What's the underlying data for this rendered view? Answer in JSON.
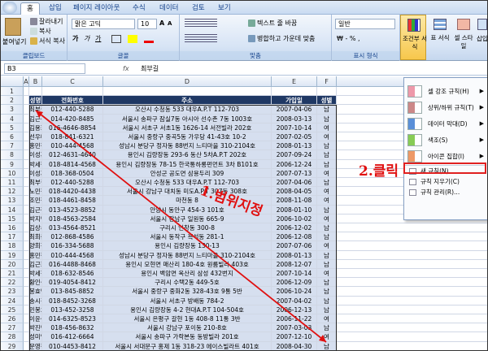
{
  "ribbon": {
    "tabs": [
      "홈",
      "삽입",
      "페이지 레이아웃",
      "수식",
      "데이터",
      "검토",
      "보기"
    ],
    "paste": "붙여넣기",
    "cut": "잘라내기",
    "copy": "복사",
    "format_painter": "서식 복사",
    "clipboard_group": "클립보드",
    "font_name": "맑은 고딕",
    "font_size": "10",
    "font_group": "글꼴",
    "wrap_text": "텍스트 줄 바꿈",
    "merge_center": "병합하고 가운데 맞춤",
    "align_group": "맞춤",
    "number_format": "일반",
    "number_group": "표시 형식",
    "cond_format": "조건부 서식",
    "table_format": "표 서식",
    "cell_style": "셀 스타일",
    "insert": "삽입"
  },
  "formula_bar": {
    "name_box": "B3",
    "fx": "fx",
    "value": "최부길"
  },
  "columns": [
    "A",
    "B",
    "C",
    "D",
    "E",
    "F",
    "G"
  ],
  "headers": [
    "성명",
    "전화번호",
    "주소",
    "가입일",
    "성별"
  ],
  "rows": [
    [
      "최부길",
      "012-440-5288",
      "오산시 수청동 533 대우A.P.T 112-703",
      "2007-04-06",
      "남"
    ],
    [
      "김근식",
      "014-420-8485",
      "서울시 송파구 잠실7동 아시아 선수촌 7동 1003호",
      "2008-03-13",
      "남"
    ],
    [
      "김용희",
      "016-4646-8854",
      "서울시 서초구 서초1동 1626-14 서전빌라 202호",
      "2007-10-14",
      "여"
    ],
    [
      "선우미경",
      "018-841-6321",
      "서울시 중랑구 중곡5동 가우당 41-43호 10-2",
      "2007-02-05",
      "여"
    ],
    [
      "홍민철",
      "010-444-4568",
      "성남시 분당구 정자동 88번지 느티마을 310-2104호",
      "2008-01-13",
      "남"
    ],
    [
      "이성훈",
      "012-4631-4640",
      "용인시 김량장동 293-6 동산 5차A.P.T 202호",
      "2007-09-24",
      "남"
    ],
    [
      "박세철",
      "018-4814-4568",
      "용인시 김량장동 78-15 한국통하롱펀먼트 3차 B101호",
      "2006-12-24",
      "남"
    ],
    [
      "이성훈",
      "018-368-0504",
      "안성군 공도면 삼용두리 309",
      "2007-07-13",
      "여"
    ],
    [
      "최부길",
      "012-440-5288",
      "오산시 수청동 533 대우A.P.T 112-703",
      "2007-04-06",
      "남"
    ],
    [
      "노민정",
      "018-4420-4438",
      "서울시 강남구 대치동 미도A.P.T 307동 308호",
      "2008-04-05",
      "여"
    ],
    [
      "조민정",
      "018-4461-8458",
      "마천동 8",
      "2008-11-08",
      "여"
    ],
    [
      "김근정",
      "013-4523-8852",
      "안양시 동안구 454-3 101호",
      "2008-01-10",
      "남"
    ],
    [
      "박지민",
      "018-4563-2584",
      "서울시 강남구 일원동 665-9",
      "2006-10-02",
      "여"
    ],
    [
      "김상수",
      "013-4564-8521",
      "구리시 인창동 300-8",
      "2006-12-02",
      "남"
    ],
    [
      "최희준",
      "012-868-4586",
      "서울시 동작구 흑석동 281-1",
      "2006-12-08",
      "남"
    ],
    [
      "양희진",
      "016-334-5688",
      "용인시 김량장동 130-13",
      "2007-07-06",
      "여"
    ],
    [
      "홍민철",
      "010-444-4568",
      "성남시 분당구 정자동 88번지 느티마을 310-2104호",
      "2008-01-13",
      "남"
    ],
    [
      "김근희",
      "016-4488-8468",
      "용인시 모현면 매산리 180-4호 원룸빌라 403호",
      "2008-12-07",
      "남"
    ],
    [
      "박세진",
      "018-632-8546",
      "용인시 백암면 옥산리 삼성 432번지",
      "2007-10-14",
      "여"
    ],
    [
      "황인성",
      "019-4054-8412",
      "구리시 수택2동 449-5호",
      "2006-12-09",
      "남"
    ],
    [
      "봉효민",
      "013-845-8852",
      "서울시 중랑구 중화2동 328-43호 9통 5반",
      "2006-10-24",
      "남"
    ],
    [
      "송시경",
      "018-8452-3268",
      "서울시 서초구 방배동 784-2",
      "2007-04-02",
      "남"
    ],
    [
      "민봉호",
      "013-452-3258",
      "용인시 김량장동 4-2 현대A.P.T 104-504호",
      "2006-12-13",
      "남"
    ],
    [
      "이윤성",
      "014-6325-8523",
      "서울시 은평구 갈현 1동 408-8 11통 3반",
      "2006-11-22",
      "여"
    ],
    [
      "박진민",
      "018-456-8632",
      "서울시 강남구 포이동 210-8호",
      "2007-03-03",
      "남"
    ],
    [
      "성미영",
      "016-412-6664",
      "서울시 송파구 가락본동 동방빌라 201호",
      "2007-12-10",
      "여"
    ],
    [
      "문영철",
      "010-4453-8412",
      "서울시 서대문구 홍제 1동 318-23 에이스빌라트 401호",
      "2008-04-30",
      "남"
    ]
  ],
  "menu": {
    "items": [
      "셀 강조 규칙(H)",
      "상위/하위 규칙(T)",
      "데이터 막대(D)",
      "색조(S)",
      "아이콘 집합(I)"
    ],
    "subitems": [
      "새 규칙(N)...",
      "규칙 지우기(C)",
      "규칙 관리(R)..."
    ]
  },
  "annotations": {
    "step1": "1.범위지정",
    "step2": "2.클릭"
  }
}
